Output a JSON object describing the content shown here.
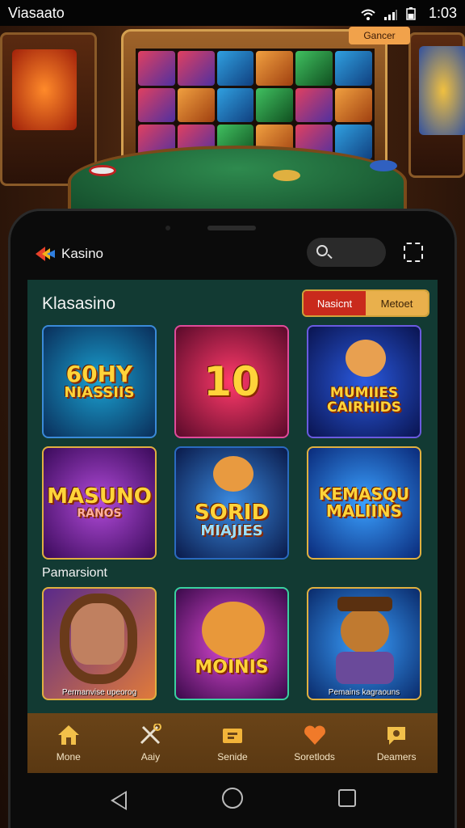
{
  "status_bar": {
    "carrier": "Viasaato",
    "time": "1:03",
    "icons": [
      "wifi-icon",
      "signal-icon",
      "battery-icon"
    ]
  },
  "background": {
    "badge_label": "Gancer"
  },
  "app": {
    "brand_name": "Kasino",
    "search_icon": "search-icon",
    "scan_icon": "scan-icon"
  },
  "main": {
    "section_title": "Klasasino",
    "segment": {
      "options": [
        "Nasicnt",
        "Metoet"
      ],
      "selected": "Nasicnt"
    },
    "section2_title": "Pamarsiont",
    "games": [
      {
        "title_line1": "60HY",
        "title_line2": "NIASSIIS",
        "caption": ""
      },
      {
        "title_line1": "10",
        "title_line2": "",
        "caption": ""
      },
      {
        "title_line1": "MUMIIES",
        "title_line2": "CAIRHIDS",
        "caption": ""
      },
      {
        "title_line1": "MASUNO",
        "title_line2": "RANOS",
        "caption": ""
      },
      {
        "title_line1": "SORID",
        "title_line2": "MIAJIES",
        "caption": ""
      },
      {
        "title_line1": "KEMASQU",
        "title_line2": "MALIINS",
        "caption": ""
      },
      {
        "title_line1": "",
        "title_line2": "",
        "caption": "Permanvise upeorog"
      },
      {
        "title_line1": "MOINIS",
        "title_line2": "",
        "caption": ""
      },
      {
        "title_line1": "",
        "title_line2": "",
        "caption": "Pemains kagraouns"
      }
    ]
  },
  "bottom_nav": {
    "items": [
      {
        "label": "Mone",
        "icon": "home-icon"
      },
      {
        "label": "Aaiy",
        "icon": "tools-icon"
      },
      {
        "label": "Senide",
        "icon": "ticket-icon"
      },
      {
        "label": "Soretlods",
        "icon": "heart-icon"
      },
      {
        "label": "Deamers",
        "icon": "chat-icon"
      }
    ]
  },
  "colors": {
    "accent_gold": "#f0b84a",
    "segment_active": "#c92a1c",
    "content_bg": "#123a33",
    "nav_bg": "#6a4418"
  }
}
